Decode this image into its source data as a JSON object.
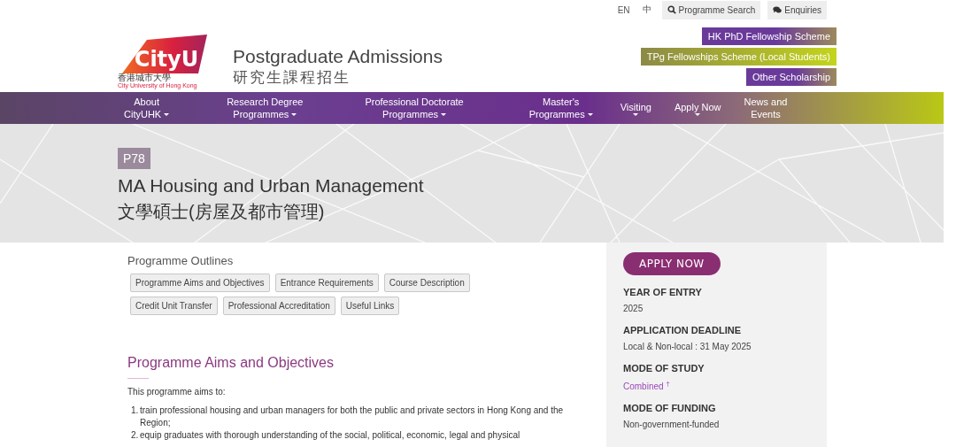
{
  "top_bar": {
    "languages": [
      "EN",
      "中"
    ],
    "buttons": [
      {
        "label": "Programme Search",
        "kind": "search"
      },
      {
        "label": "Enquiries",
        "kind": "chat"
      }
    ]
  },
  "header": {
    "logo": {
      "wordmark": "CityU",
      "name_zh": "香港城市大學",
      "name_en": "City University of Hong Kong"
    },
    "title": "Postgraduate Admissions",
    "title_zh": "研究生課程招生"
  },
  "scholarships": [
    {
      "label": "HK PhD Fellowship Scheme",
      "kind": "purple"
    },
    {
      "label": "TPg Fellowships Scheme (Local Students)",
      "kind": "lime"
    },
    {
      "label": "Other Scholarship",
      "kind": "purple"
    }
  ],
  "nav": [
    {
      "lines": [
        "About",
        "CityUHK"
      ],
      "dropdown": true
    },
    {
      "lines": [
        "Research Degree",
        "Programmes"
      ],
      "dropdown": true
    },
    {
      "lines": [
        "Professional Doctorate",
        "Programmes"
      ],
      "dropdown": true
    },
    {
      "lines": [
        "Master's",
        "Programmes"
      ],
      "dropdown": true
    },
    {
      "lines": [
        "Visiting"
      ],
      "dropdown": true
    },
    {
      "lines": [
        "Apply Now"
      ],
      "dropdown": true
    },
    {
      "lines": [
        "News and",
        "Events"
      ],
      "dropdown": false
    }
  ],
  "hero": {
    "code": "P78",
    "title": "MA Housing and Urban Management",
    "title_zh": "文學碩士(房屋及都市管理)"
  },
  "outlines": {
    "heading": "Programme Outlines",
    "buttons": [
      "Programme Aims and Objectives",
      "Entrance Requirements",
      "Course Description",
      "Credit Unit Transfer",
      "Professional Accreditation",
      "Useful Links"
    ]
  },
  "section": {
    "heading": "Programme Aims and Objectives",
    "intro": "This programme aims to:",
    "items": [
      {
        "number": "1.",
        "text": "train professional housing and urban managers for both the public and private sectors in Hong Kong and the Region;"
      },
      {
        "number": "2.",
        "text": "equip graduates with thorough understanding of the social, political, economic, legal and physical"
      }
    ]
  },
  "sidebar": {
    "apply_button": "APPLY NOW",
    "fields": [
      {
        "label": "YEAR OF ENTRY",
        "value": "2025",
        "kind": "text"
      },
      {
        "label": "APPLICATION DEADLINE",
        "value": "Local & Non-local : 31 May 2025",
        "kind": "text"
      },
      {
        "label": "MODE OF STUDY",
        "value": "Combined $^{†}$",
        "kind": "link"
      },
      {
        "label": "MODE OF FUNDING",
        "value": "Non-government-funded",
        "kind": "text"
      }
    ]
  }
}
